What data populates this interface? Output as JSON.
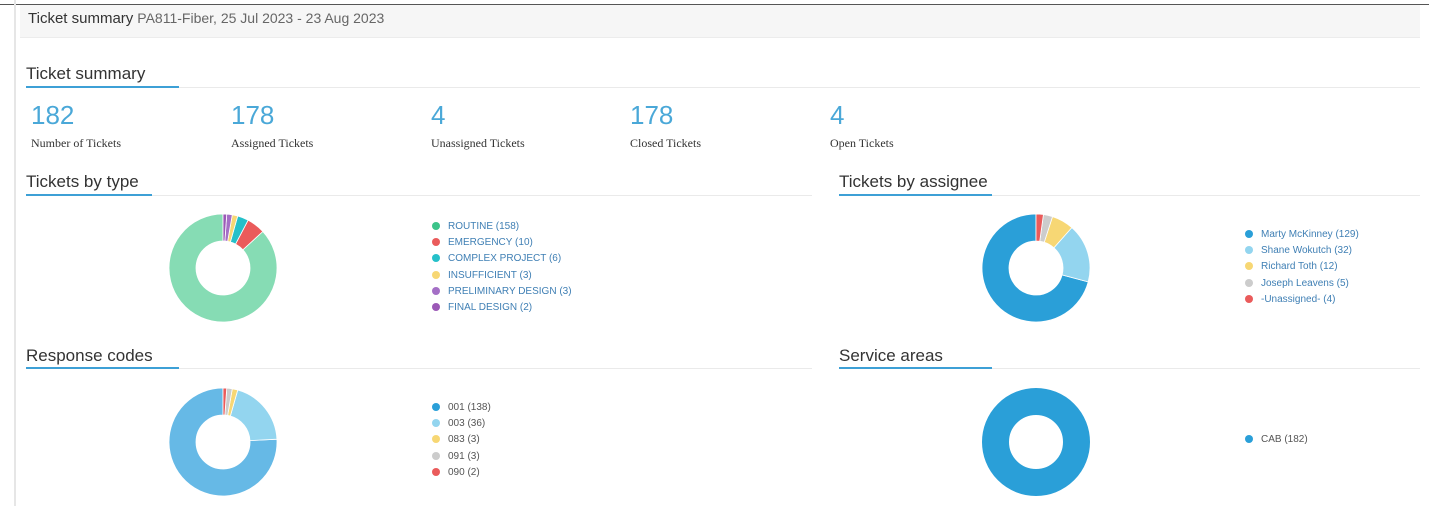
{
  "header": {
    "title": "Ticket summary",
    "subtitle": "PA811-Fiber, 25 Jul 2023 - 23 Aug 2023"
  },
  "summary": {
    "title": "Ticket summary",
    "stats": [
      {
        "value": "182",
        "label": "Number of Tickets"
      },
      {
        "value": "178",
        "label": "Assigned Tickets"
      },
      {
        "value": "4",
        "label": "Unassigned Tickets"
      },
      {
        "value": "178",
        "label": "Closed Tickets"
      },
      {
        "value": "4",
        "label": "Open Tickets"
      }
    ]
  },
  "sections": {
    "by_type": {
      "title": "Tickets by type"
    },
    "by_assignee": {
      "title": "Tickets by assignee"
    },
    "response_codes": {
      "title": "Response codes"
    },
    "service_areas": {
      "title": "Service areas"
    }
  },
  "chart_data": [
    {
      "type": "pie",
      "id": "by_type",
      "categories": [
        "ROUTINE",
        "EMERGENCY",
        "COMPLEX PROJECT",
        "INSUFFICIENT",
        "PRELIMINARY DESIGN",
        "FINAL DESIGN"
      ],
      "values": [
        158,
        10,
        6,
        3,
        3,
        2
      ],
      "labels": [
        "ROUTINE (158)",
        "EMERGENCY (10)",
        "COMPLEX PROJECT (6)",
        "INSUFFICIENT (3)",
        "PRELIMINARY DESIGN (3)",
        "FINAL DESIGN (2)"
      ],
      "colors": [
        "#86dcb4",
        "#ea5b5b",
        "#25c0c9",
        "#f7d774",
        "#a46fc6",
        "#9b59b6"
      ],
      "legend_colors": [
        "#3cc48a",
        "#ea5b5b",
        "#25c0c9",
        "#f7d774",
        "#a46fc6",
        "#9b59b6"
      ]
    },
    {
      "type": "pie",
      "id": "by_assignee",
      "categories": [
        "Marty McKinney",
        "Shane Wokutch",
        "Richard Toth",
        "Joseph Leavens",
        "-Unassigned-"
      ],
      "values": [
        129,
        32,
        12,
        5,
        4
      ],
      "labels": [
        "Marty McKinney (129)",
        "Shane Wokutch (32)",
        "Richard Toth (12)",
        "Joseph Leavens (5)",
        "-Unassigned- (4)"
      ],
      "colors": [
        "#2a9fd8",
        "#93d5ef",
        "#f7d774",
        "#cccccc",
        "#ea5b5b"
      ],
      "legend_colors": [
        "#2a9fd8",
        "#93d5ef",
        "#f7d774",
        "#cccccc",
        "#ea5b5b"
      ]
    },
    {
      "type": "pie",
      "id": "response_codes",
      "categories": [
        "001",
        "003",
        "083",
        "091",
        "090"
      ],
      "values": [
        138,
        36,
        3,
        3,
        2
      ],
      "labels": [
        "001 (138)",
        "003 (36)",
        "083 (3)",
        "091 (3)",
        "090 (2)"
      ],
      "colors": [
        "#66b9e6",
        "#93d5ef",
        "#f7d774",
        "#cccccc",
        "#ea5b5b"
      ],
      "legend_colors": [
        "#2a9fd8",
        "#93d5ef",
        "#f7d774",
        "#cccccc",
        "#ea5b5b"
      ]
    },
    {
      "type": "pie",
      "id": "service_areas",
      "categories": [
        "CAB"
      ],
      "values": [
        182
      ],
      "labels": [
        "CAB (182)"
      ],
      "colors": [
        "#2a9fd8"
      ],
      "legend_colors": [
        "#2a9fd8"
      ]
    }
  ]
}
